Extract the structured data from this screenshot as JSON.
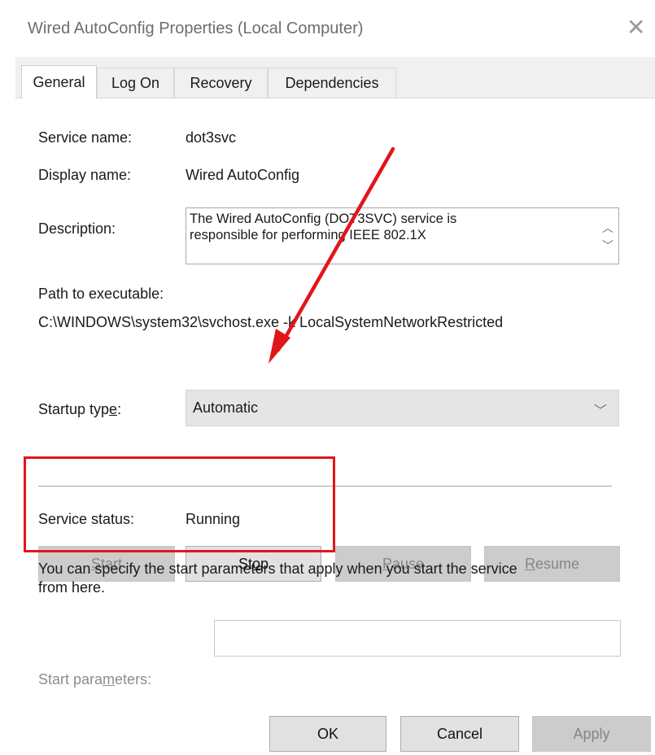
{
  "window": {
    "title": "Wired AutoConfig Properties (Local Computer)",
    "close_glyph": "✕"
  },
  "tabs": [
    "General",
    "Log On",
    "Recovery",
    "Dependencies"
  ],
  "general": {
    "service_name_label": "Service name:",
    "service_name_value": "dot3svc",
    "display_name_label": "Display name:",
    "display_name_value": "Wired AutoConfig",
    "description_label": "Description:",
    "description_line1": "The Wired AutoConfig (DOT3SVC) service is",
    "description_line2": "responsible for performing IEEE 802.1X",
    "path_label": "Path to executable:",
    "path_value": "C:\\WINDOWS\\system32\\svchost.exe -k LocalSystemNetworkRestricted",
    "startup_label_pre": "Startup typ",
    "startup_label_u": "e",
    "startup_label_post": ":",
    "startup_value": "Automatic",
    "status_label": "Service status:",
    "status_value": "Running",
    "buttons": {
      "start_u": "S",
      "start_rest": "tart",
      "stop_pre": "St",
      "stop_u": "o",
      "stop_post": "p",
      "pause_u": "P",
      "pause_rest": "ause",
      "resume_u": "R",
      "resume_rest": "esume"
    },
    "note_line1": "You can specify the start parameters that apply when you start the service",
    "note_line2": "from here.",
    "params_label_pre": "Start para",
    "params_label_u": "m",
    "params_label_post": "eters:"
  },
  "footer": {
    "ok": "OK",
    "cancel": "Cancel",
    "apply": "Apply"
  },
  "annotations": {
    "highlight_color": "#e1161a"
  }
}
